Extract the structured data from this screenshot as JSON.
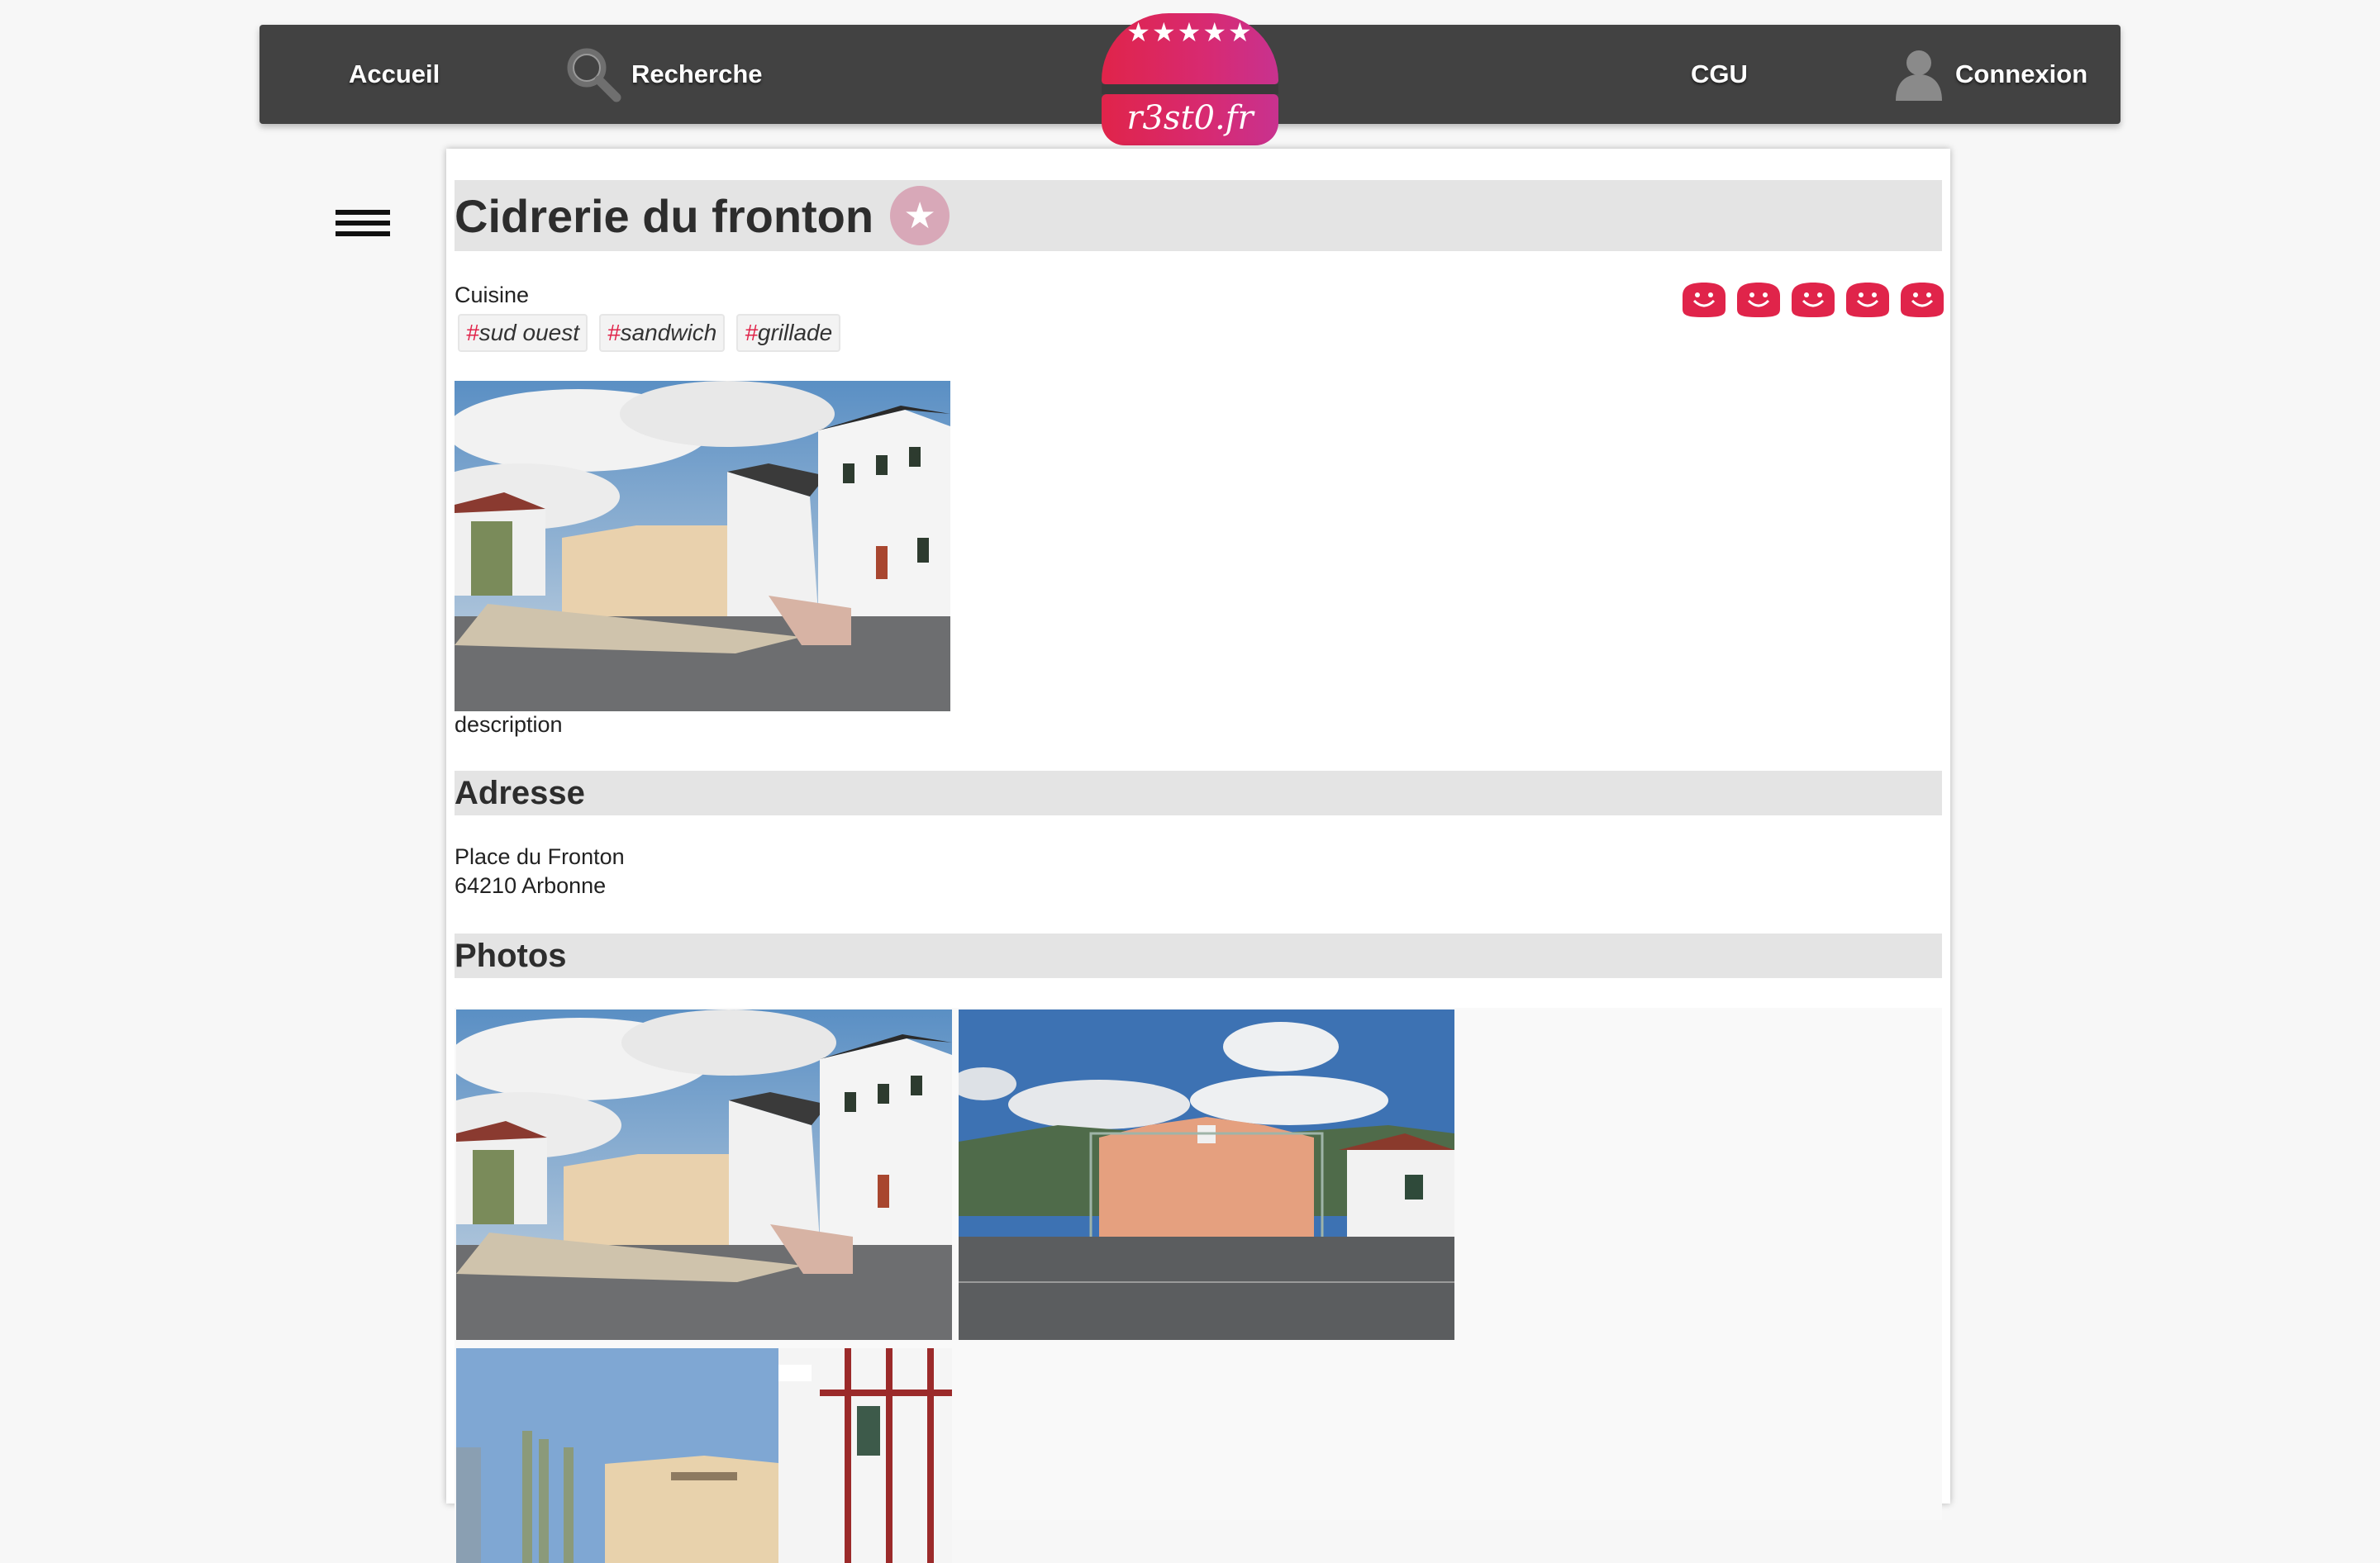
{
  "nav": {
    "home_label": "Accueil",
    "search_label": "Recherche",
    "logo_text": "r3st0.fr",
    "logo_stars": "★★★★★",
    "cgu_label": "CGU",
    "login_label": "Connexion"
  },
  "restaurant": {
    "name": "Cidrerie du fronton",
    "cuisine_label": "Cuisine",
    "tags": [
      {
        "hash": "#",
        "text": "sud ouest"
      },
      {
        "hash": "#",
        "text": "sandwich"
      },
      {
        "hash": "#",
        "text": "grillade"
      }
    ],
    "rating": 5,
    "rating_max": 5,
    "description": "description"
  },
  "address": {
    "heading": "Adresse",
    "line1": "Place du Fronton",
    "line2": "64210 Arbonne"
  },
  "photos": {
    "heading": "Photos"
  },
  "colors": {
    "accent": "#e0244a",
    "nav_bg": "#424242",
    "section_bg": "#e4e4e4"
  }
}
